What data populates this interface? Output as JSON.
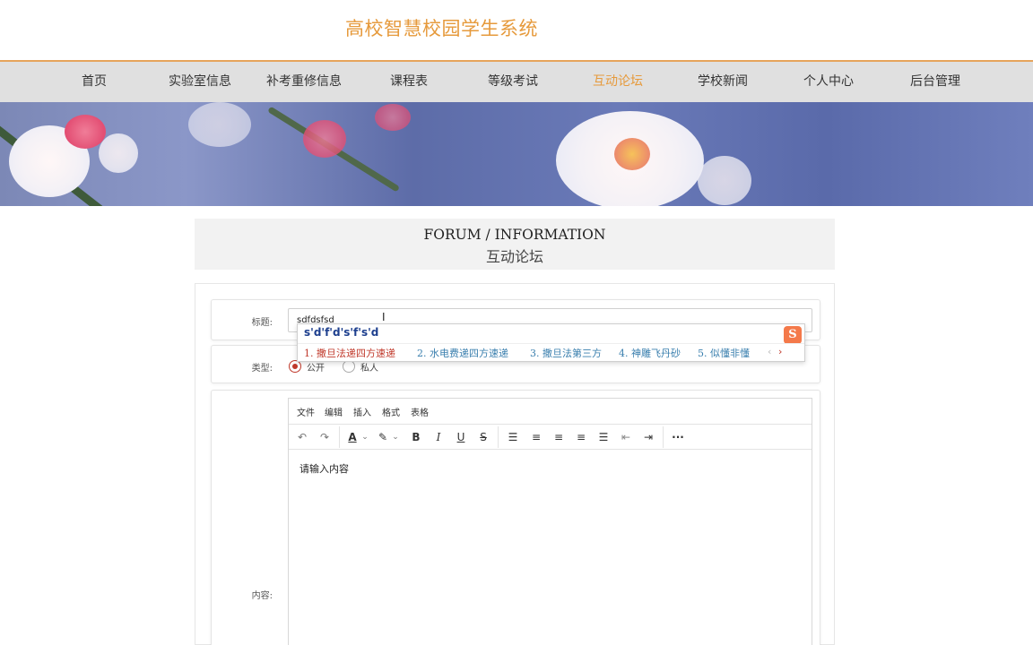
{
  "site": {
    "title": "高校智慧校园学生系统"
  },
  "nav": {
    "items": [
      {
        "label": "首页"
      },
      {
        "label": "实验室信息"
      },
      {
        "label": "补考重修信息"
      },
      {
        "label": "课程表"
      },
      {
        "label": "等级考试"
      },
      {
        "label": "互动论坛",
        "active": true
      },
      {
        "label": "学校新闻"
      },
      {
        "label": "个人中心"
      },
      {
        "label": "后台管理"
      }
    ]
  },
  "banner": {
    "dots": 3,
    "active_dot": 0
  },
  "section": {
    "title_en": "FORUM / INFORMATION",
    "title_cn": "互动论坛"
  },
  "form": {
    "title_label": "标题:",
    "title_value": "sdfdsfsd",
    "type_label": "类型:",
    "type_options": [
      {
        "label": "公开",
        "checked": true
      },
      {
        "label": "私人",
        "checked": false
      }
    ],
    "content_label": "内容:",
    "editor": {
      "menu": [
        "文件",
        "编辑",
        "插入",
        "格式",
        "表格"
      ],
      "placeholder": "请输入内容",
      "toolbar_icons": [
        "undo-icon",
        "redo-icon",
        "text-color-icon",
        "highlight-color-icon",
        "bold-icon",
        "italic-icon",
        "underline-icon",
        "strikethrough-icon",
        "list-icon",
        "align-left-icon",
        "align-center-icon",
        "align-right-icon",
        "justify-icon",
        "outdent-icon",
        "indent-icon",
        "more-icon"
      ]
    }
  },
  "ime": {
    "composition": "s'd'f'd's'f's'd",
    "candidates": [
      "1. 撒旦法递四方速递",
      "2. 水电费递四方速递",
      "3. 撒旦法第三方",
      "4. 神雕飞丹砂",
      "5. 似懂非懂"
    ],
    "logo": "S"
  },
  "colors": {
    "accent": "#e69a3c",
    "nav_bg": "#e0e0e0",
    "radio_checked": "#c0392b",
    "ime_text": "#1d3f8e"
  }
}
